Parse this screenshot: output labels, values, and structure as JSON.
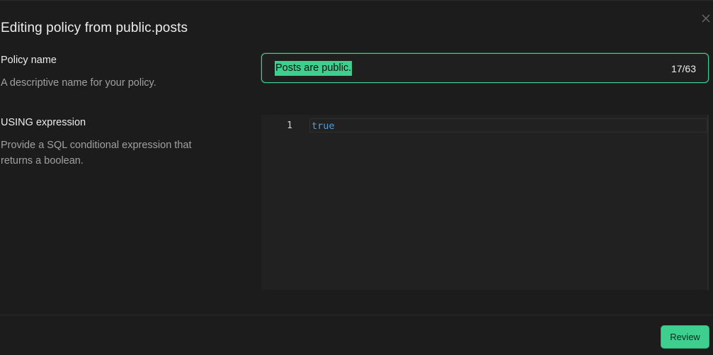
{
  "dialog": {
    "title": "Editing policy from public.posts",
    "close_icon": "close-icon"
  },
  "policy_name": {
    "label": "Policy name",
    "description": "A descriptive name for your policy.",
    "value": "Posts are public.",
    "counter": "17/63"
  },
  "using_expression": {
    "label": "USING expression",
    "description": "Provide a SQL conditional expression that returns a boolean.",
    "line_number": "1",
    "code": "true"
  },
  "footer": {
    "review_label": "Review"
  },
  "colors": {
    "accent": "#3ecf8e",
    "background": "#1c1c1c",
    "editor_background": "#212121",
    "keyword": "#569cd6"
  }
}
